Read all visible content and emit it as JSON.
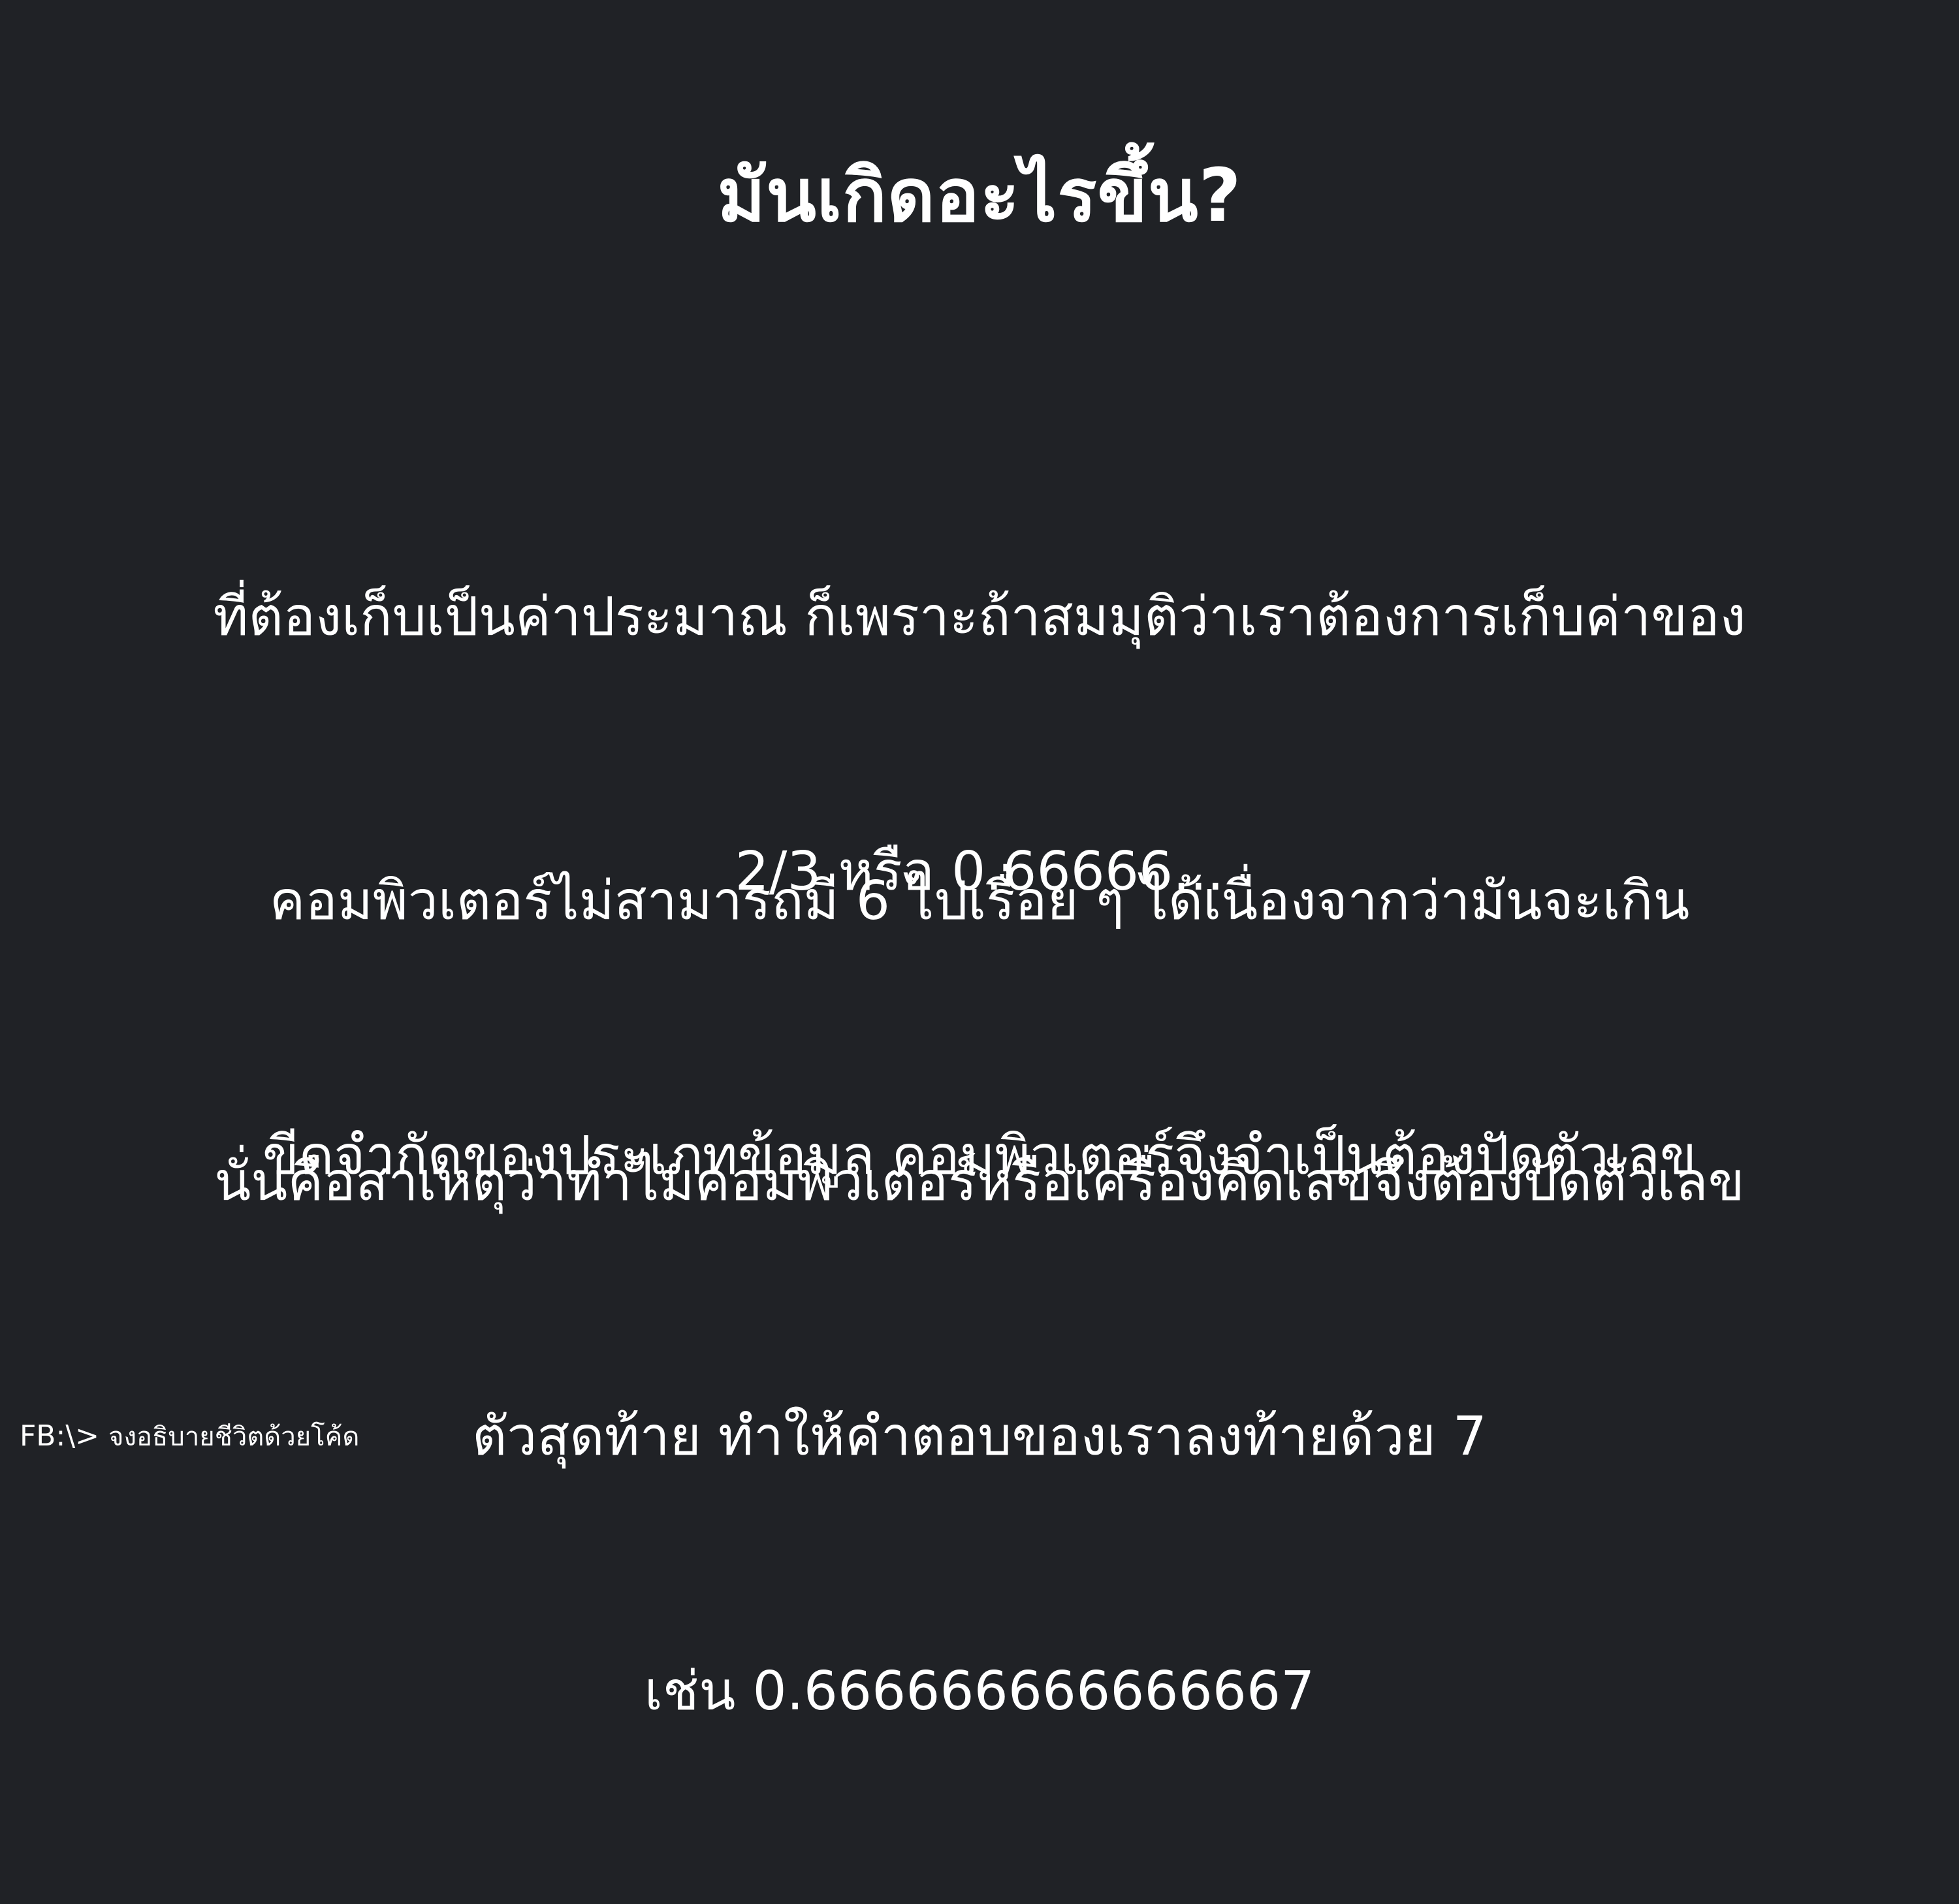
{
  "title": "มันเกิดอะไรขึ้น?",
  "paragraphs": [
    {
      "lines": [
        "ที่ต้องเก็บเป็นค่าประมาณ ก็เพราะถ้าสมมุติว่าเราต้องการเก็บค่าของ",
        "2/3 หรือ 0.66666..."
      ]
    },
    {
      "lines": [
        "คอมพิวเตอร์ไม่สามารถมี 6 ไปเรื่อย ๆ ได้เนื่องจากว่ามันจะเกิน",
        "ขีดจำกัดของประเภทข้อมูล คอมพิวเตอร์จึงจำเป็นต้องปัดตัวเลข"
      ]
    },
    {
      "lines": [
        "นั่นคือสาเหตุว่าทำไมคอมพิวเตอร์หรือเครื่องคิดเลขจึงต้องปัดตัวเลข",
        "ตัวสุดท้าย ทำให้คำตอบของเราลงท้ายด้วย 7",
        "เช่น 0.666666666666667"
      ]
    }
  ],
  "footer": {
    "handle": "FB:\\>",
    "name": "จงอธิบายชีวิตด้วยโค้ด"
  }
}
